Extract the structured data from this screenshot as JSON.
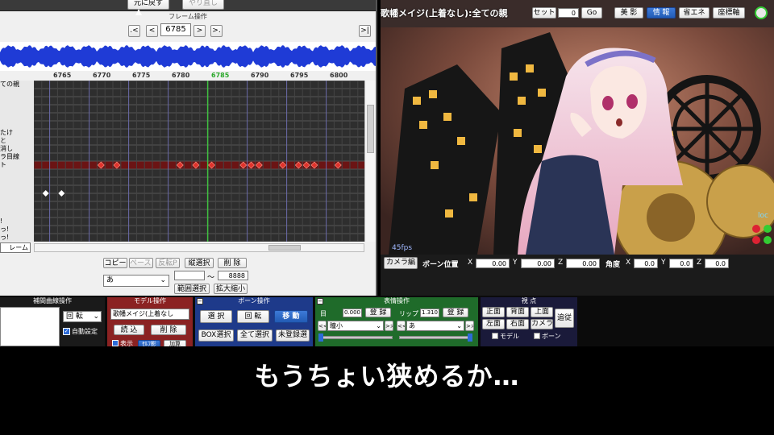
{
  "timeline": {
    "undo_label": "元に戻す",
    "redo_label": "やり直し",
    "title": "フレーム操作",
    "prev_key": ".<",
    "prev_frame": "<",
    "current_frame": "6785",
    "next_frame": ">",
    "next_key": ">.",
    "last_frame": ">|",
    "ruler_ticks": [
      "6765",
      "6770",
      "6775",
      "6780",
      "6785",
      "6790",
      "6795",
      "6800"
    ],
    "track_names": [
      "ての親",
      "",
      "",
      "",
      "",
      "",
      "たけ",
      "と",
      "消し",
      "ラ目線",
      "ト",
      "",
      "",
      "",
      "",
      "",
      "",
      "!",
      "っ!",
      "っ!"
    ],
    "frame_tab": "レーム",
    "copy": "コピー",
    "paste": "ペースト",
    "reverse_paste": "反転P",
    "column_select": "縦選択",
    "delete": "削 除",
    "dropdown": "あ",
    "range_from": "",
    "range_tilde": "～",
    "range_to": "8888",
    "range_select": "範囲選択",
    "scale": "拡大縮小"
  },
  "viewport": {
    "title": "歌幡メイジ(上着なし):全ての親",
    "set_button": "セット",
    "frame_value": "0",
    "go_button": "Go",
    "tab_beauty": "美 影",
    "tab_info": "情 報",
    "tab_eco": "省エネ",
    "tab_axis": "座標軸",
    "fps": "45fps",
    "loc_label": "loc"
  },
  "camera_bar": {
    "tab": "カメラ編",
    "bone_pos_label": "ボーン位置",
    "x_label": "X",
    "x_value": "0.00",
    "y_label": "Y",
    "y_value": "0.00",
    "z_label": "Z",
    "z_value": "0.00",
    "angle_label": "角度",
    "ax_label": "X",
    "ax_value": "0.0",
    "ay_label": "Y",
    "ay_value": "0.0",
    "az_label": "Z",
    "az_value": "0.0"
  },
  "interp_panel": {
    "title": "補間曲線操作",
    "rotate_select": "回 転",
    "auto_setting": "自動設定"
  },
  "model_panel": {
    "title": "モデル操作",
    "model_select": "歌幡メイジ(上着なし",
    "load": "読 込",
    "delete": "削 除",
    "show": "表示",
    "shadow": "ｾﾙﾌ影",
    "add": "加算"
  },
  "bone_panel": {
    "title": "ボーン操作",
    "select": "選 択",
    "rotate": "回 転",
    "move": "移 動",
    "box_select": "BOX選択",
    "select_all": "全て選択",
    "unregistered": "未登録選"
  },
  "morph_panel": {
    "title": "表情操作",
    "eye_label": "目",
    "eye_value": "0.000",
    "eye_register": "登 録",
    "lip_label": "リップ",
    "lip_value": "1.310",
    "lip_register": "登 録",
    "eye_select": "瞳小",
    "lip_select": "あ"
  },
  "view_panel": {
    "title": "視 点",
    "front": "正面",
    "back": "背面",
    "top": "上面",
    "follow": "追従",
    "left": "左面",
    "right": "右面",
    "camera": "カメラ",
    "model_check": "モデル",
    "bone_check": "ボーン"
  },
  "subtitle": "もうちょい狭めるか…",
  "colors": {
    "panel_model": "#8b2222",
    "panel_bone": "#1e3a8a",
    "panel_morph": "#1f6b2a",
    "panel_view": "#1a1a3a",
    "keyframe_red": "#e0322c",
    "current_frame_line": "#3fbf3f"
  }
}
